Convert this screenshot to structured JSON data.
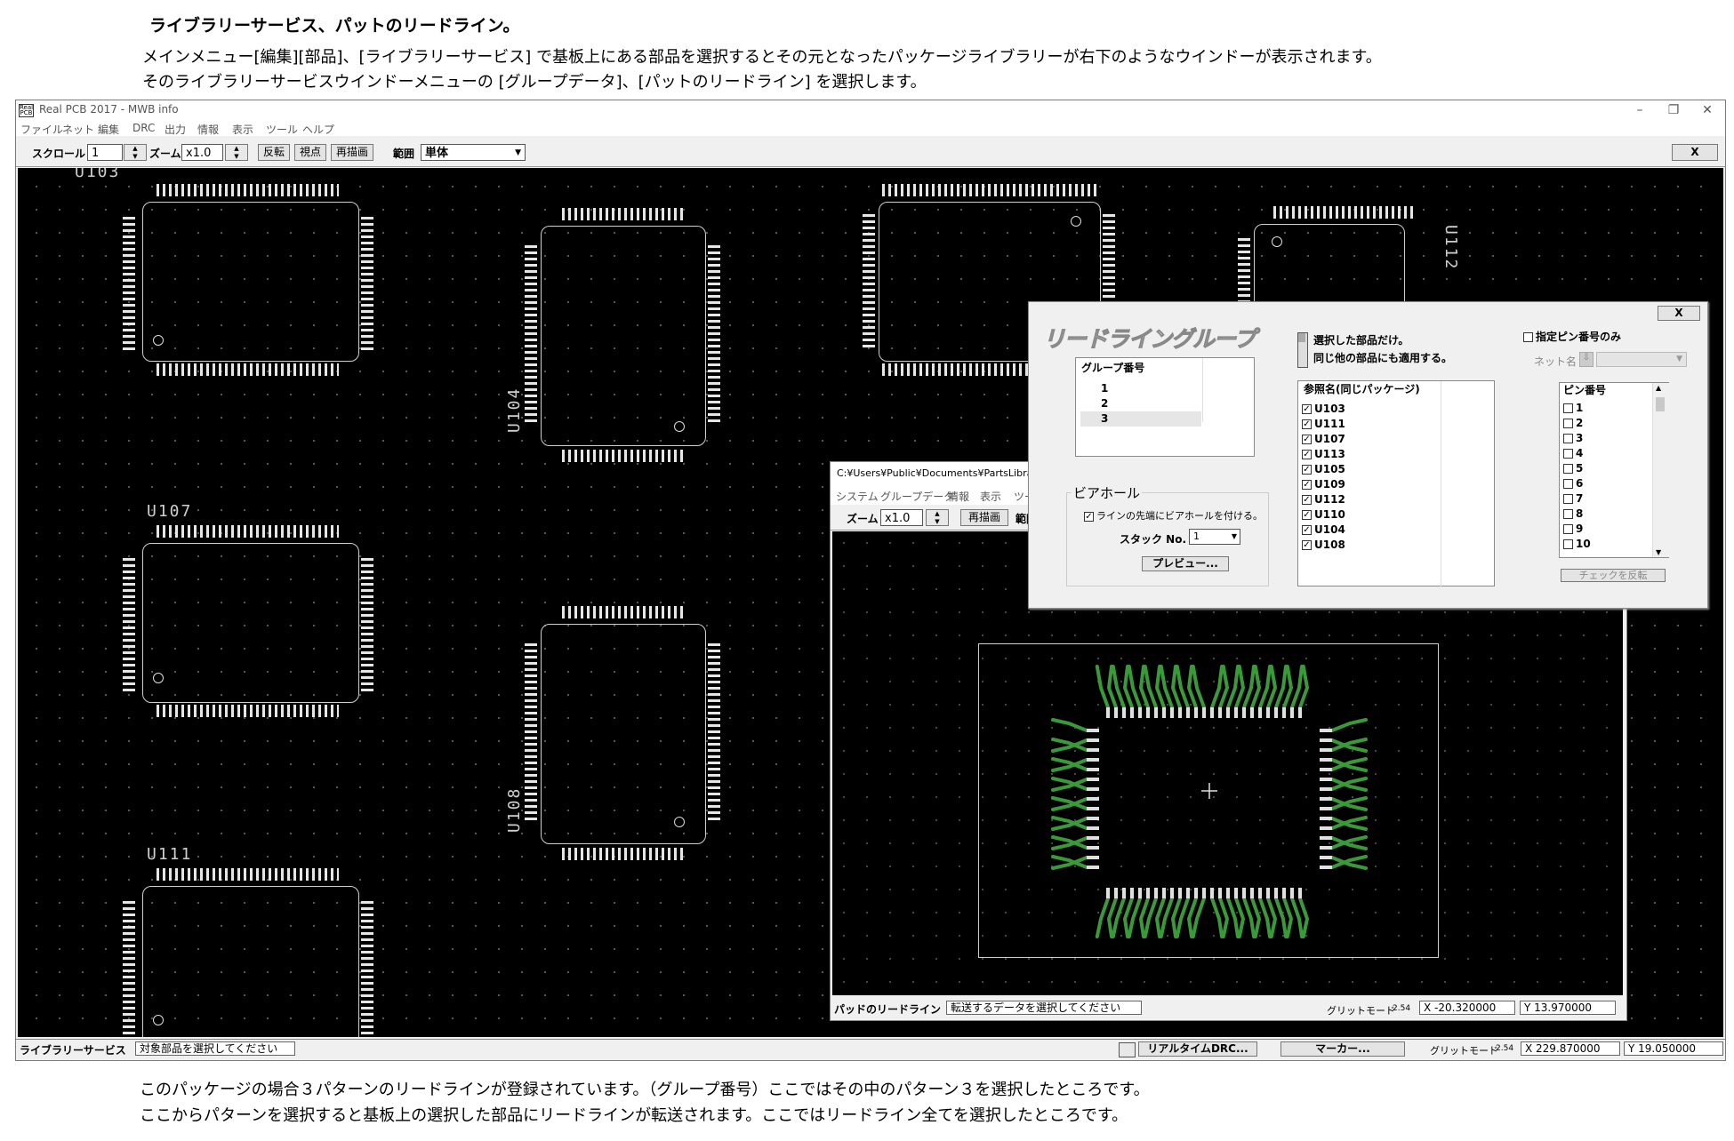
{
  "doc": {
    "heading": "ライブラリーサービス、パットのリードライン。",
    "intro1": "メインメニュー[編集][部品]、[ライブラリーサービス] で基板上にある部品を選択するとその元となったパッケージライブラリーが右下のようなウインドーが表示されます。",
    "intro2": "そのライブラリーサービスウインドーメニューの [グループデータ]、[パットのリードライン] を選択します。",
    "outro1": "このパッケージの場合３パターンのリードラインが登録されています。（グループ番号）ここではその中のパターン３を選択したところです。",
    "outro2": "ここからパターンを選択すると基板上の選択した部品にリードラインが転送されます。ここではリードライン全てを選択したところです。"
  },
  "main": {
    "title": "Real PCB 2017 - MWB info",
    "icon_text": "Real PCB",
    "controls": [
      "–",
      "❐",
      "✕"
    ],
    "menu": [
      "ファイル",
      "ネット",
      "編集",
      "DRC",
      "出力",
      "情報",
      "表示",
      "ツール",
      "ヘルプ"
    ],
    "toolbar": {
      "scroll_label": "スクロール",
      "scroll_value": "1",
      "zoom_label": "ズーム",
      "zoom_value": "x1.0",
      "flip_btn": "反転",
      "view_btn": "視点",
      "redraw_btn": "再描画",
      "range_label": "範囲",
      "range_value": "単体",
      "close_btn": "X"
    },
    "chips": {
      "u103": "U103",
      "u104": "U104",
      "u107": "U107",
      "u108": "U108",
      "u111": "U111",
      "u112": "U112"
    },
    "status": {
      "mode": "ライブラリーサービス",
      "message": "対象部品を選択してください",
      "realtime_drc": "リアルタイムDRC...",
      "marker": "マーカー...",
      "grid_label": "グリットモード",
      "grid_value": "2.54",
      "x": "X 229.870000",
      "y": "Y 19.050000"
    }
  },
  "library": {
    "title": "C:¥Users¥Public¥Documents¥PartsLibrary",
    "menu": [
      "システム",
      "グループデータ",
      "情報",
      "表示",
      "ツー"
    ],
    "zoom_label": "ズーム",
    "zoom_value": "x1.0",
    "redraw_btn": "再描画",
    "range_label": "範囲",
    "status": {
      "mode": "パッドのリードライン",
      "message": "転送するデータを選択してください",
      "grid_label": "グリットモード",
      "grid_value": "2.54",
      "x": "X -20.320000",
      "y": "Y 13.970000"
    }
  },
  "dialog": {
    "close_btn": "X",
    "title": "リードライングループ",
    "group_header": "グループ番号",
    "groups": [
      "1",
      "2",
      "3"
    ],
    "selected_group": "3",
    "opt_selected_only": "選択した部品だけ。",
    "opt_apply_same": "同じ他の部品にも適用する。",
    "ref_header": "参照名(同じパッケージ)",
    "refs": [
      "U103",
      "U111",
      "U107",
      "U113",
      "U105",
      "U109",
      "U112",
      "U110",
      "U104",
      "U108"
    ],
    "pin_only": "指定ピン番号のみ",
    "net_label": "ネット名",
    "net_btn": "⇩",
    "pin_header": "ピン番号",
    "pins": [
      "1",
      "2",
      "3",
      "4",
      "5",
      "6",
      "7",
      "8",
      "9",
      "10"
    ],
    "invert_btn": "チェックを反転",
    "via_title": "ビアホール",
    "via_option": "ラインの先端にビアホールを付ける。",
    "stack_label": "スタック No.",
    "stack_value": "1",
    "preview_btn": "プレビュー..."
  }
}
